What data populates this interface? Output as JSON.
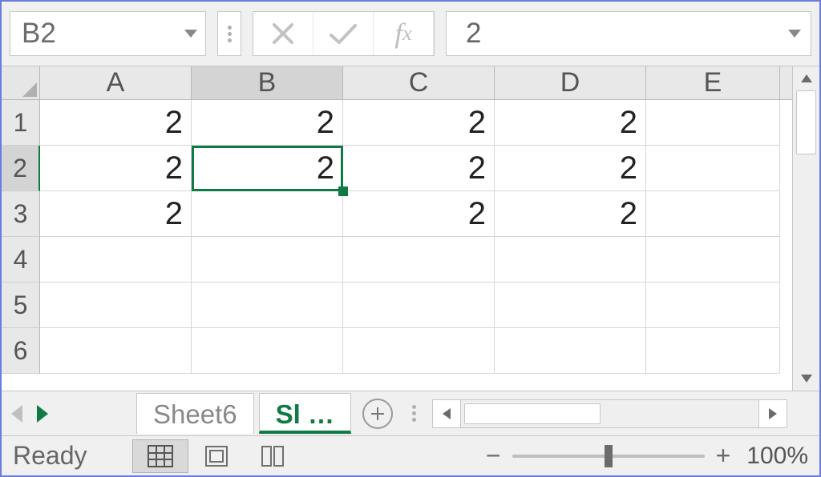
{
  "formula_bar": {
    "name_box_value": "B2",
    "formula_value": "2"
  },
  "columns": {
    "a": "A",
    "b": "B",
    "c": "C",
    "d": "D",
    "e": "E"
  },
  "rows": {
    "r1": "1",
    "r2": "2",
    "r3": "3",
    "r4": "4",
    "r5": "5",
    "r6": "6"
  },
  "cells": {
    "A1": "2",
    "B1": "2",
    "C1": "2",
    "D1": "2",
    "A2": "2",
    "B2": "2",
    "C2": "2",
    "D2": "2",
    "A3": "2",
    "C3": "2",
    "D3": "2"
  },
  "active_cell": "B2",
  "tabs": {
    "inactive": "Sheet6",
    "active_truncated": "Sl …"
  },
  "status": {
    "ready": "Ready",
    "zoom": "100%"
  }
}
